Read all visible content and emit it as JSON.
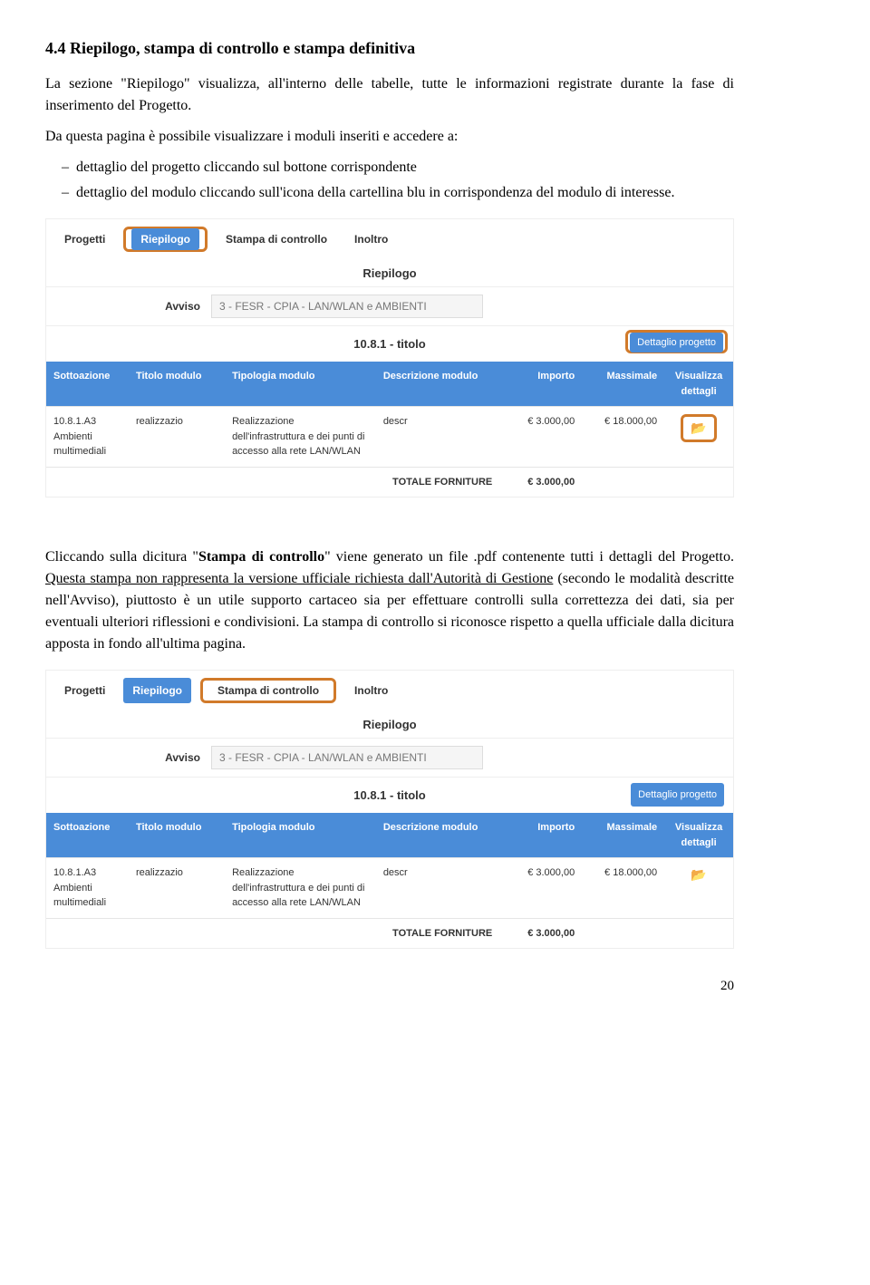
{
  "section": {
    "heading": "4.4 Riepilogo, stampa di controllo e stampa definitiva",
    "p1": "La sezione \"Riepilogo\" visualizza, all'interno delle tabelle, tutte le informazioni registrate durante la fase di inserimento del Progetto.",
    "p2": "Da questa pagina è possibile visualizzare i moduli inseriti e accedere a:",
    "li1": "dettaglio del progetto cliccando sul bottone corrispondente",
    "li2": "dettaglio del modulo cliccando sull'icona della cartellina blu in corrispondenza del modulo di interesse.",
    "p3a": "Cliccando sulla dicitura \"",
    "p3b": "Stampa di controllo",
    "p3c": "\" viene generato un file .pdf contenente tutti i dettagli del Progetto. ",
    "p3d": "Questa stampa non rappresenta la versione ufficiale richiesta dall'Autorità di Gestione",
    "p3e": " (secondo le modalità descritte nell'Avviso), piuttosto è un utile supporto cartaceo sia per effettuare controlli sulla correttezza dei dati, sia per eventuali ulteriori riflessioni e condivisioni. La stampa di controllo si riconosce rispetto a quella ufficiale dalla dicitura apposta in fondo all'ultima pagina."
  },
  "shot": {
    "tabs": {
      "progetti": "Progetti",
      "riepilogo": "Riepilogo",
      "stampa": "Stampa di controllo",
      "inoltro": "Inoltro"
    },
    "panelTitle": "Riepilogo",
    "avvisoLabel": "Avviso",
    "avvisoValue": "3 - FESR - CPIA - LAN/WLAN e AMBIENTI",
    "subTitle": "10.8.1 - titolo",
    "detailBtn": "Dettaglio progetto",
    "headers": {
      "sottoazione": "Sottoazione",
      "titolo": "Titolo modulo",
      "tipologia": "Tipologia modulo",
      "descrizione": "Descrizione modulo",
      "importo": "Importo",
      "massimale": "Massimale",
      "visualizza": "Visualizza dettagli"
    },
    "row": {
      "sottoazione": "10.8.1.A3 Ambienti multimediali",
      "titolo": "realizzazio",
      "tipologia": "Realizzazione dell'infrastruttura e dei punti di accesso alla rete LAN/WLAN",
      "descrizione": "descr",
      "importo": "€ 3.000,00",
      "massimale": "€ 18.000,00"
    },
    "totalLabel": "TOTALE FORNITURE",
    "totalValue": "€ 3.000,00"
  },
  "pageNumber": "20"
}
